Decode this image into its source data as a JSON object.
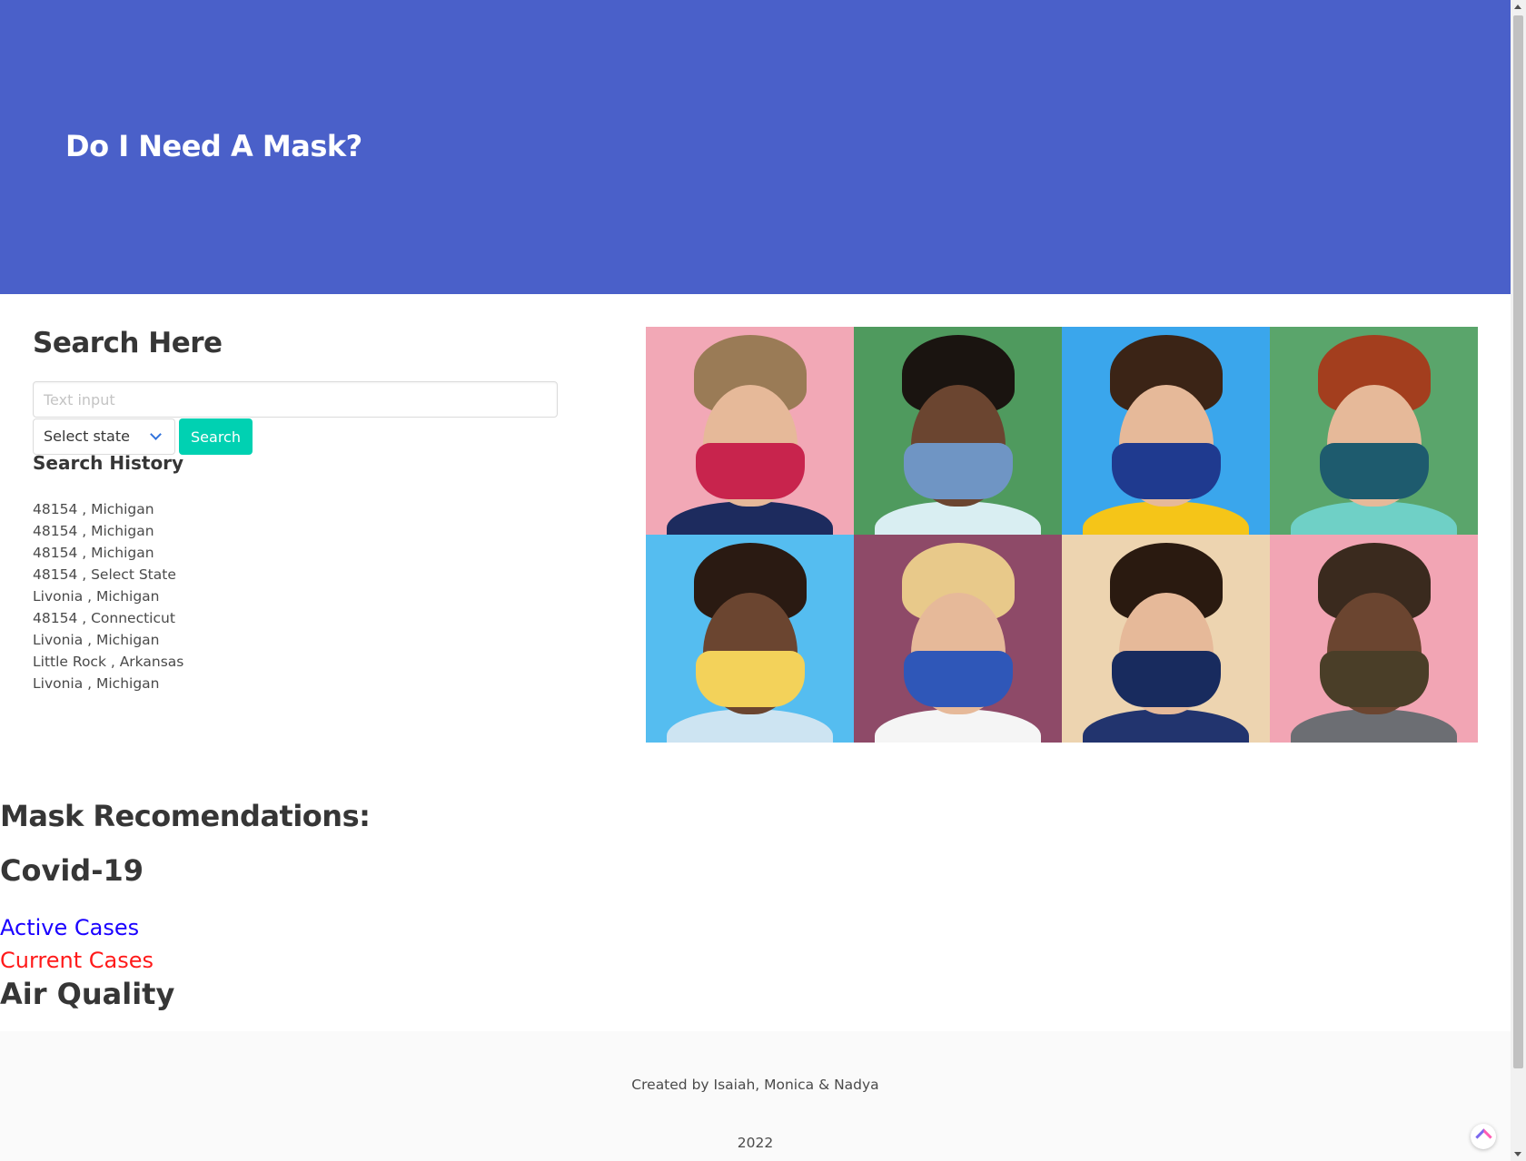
{
  "hero": {
    "title": "Do I Need A Mask?",
    "color": "#4a60c9"
  },
  "search": {
    "heading": "Search Here",
    "input_placeholder": "Text input",
    "input_value": "",
    "state_select_value": "Select state",
    "button_label": "Search",
    "button_color": "#00d1b2"
  },
  "history": {
    "heading": "Search History",
    "items": [
      "48154 , Michigan",
      "48154 , Michigan",
      "48154 , Michigan",
      "48154 , Select State",
      "Livonia , Michigan",
      "48154 , Connecticut",
      "Livonia , Michigan",
      "Little Rock , Arkansas",
      "Livonia , Michigan"
    ]
  },
  "photos": [
    {
      "bg": "#f2a8b6",
      "mask": "#c8244d",
      "hair": "#9a7b56",
      "shirt": "#1d2b5e"
    },
    {
      "bg": "#4f9a5e",
      "mask": "#6f95c4",
      "hair": "#1a1410",
      "shirt": "#d9eef2"
    },
    {
      "bg": "#3aa6ec",
      "mask": "#1f3a8f",
      "hair": "#3b2416",
      "shirt": "#f5c518"
    },
    {
      "bg": "#5aa56b",
      "mask": "#1e5b6e",
      "hair": "#a33e1e",
      "shirt": "#6fd0c6"
    },
    {
      "bg": "#55bdf0",
      "mask": "#f3d25a",
      "hair": "#2a1a12",
      "shirt": "#cde4f2"
    },
    {
      "bg": "#8e4a68",
      "mask": "#2f57b8",
      "hair": "#e8c98a",
      "shirt": "#f5f5f5"
    },
    {
      "bg": "#edd4b0",
      "mask": "#182b5e",
      "hair": "#2a1a10",
      "shirt": "#22346e"
    },
    {
      "bg": "#f2a5b4",
      "mask": "#4a3e28",
      "hair": "#3a2a1e",
      "shirt": "#6c6e73"
    }
  ],
  "recommendations": {
    "heading": "Mask Recomendations:",
    "covid_heading": "Covid-19",
    "active_cases_label": "Active Cases",
    "current_cases_label": "Current Cases",
    "air_quality_heading": "Air Quality"
  },
  "footer": {
    "credit": "Created by Isaiah, Monica & Nadya",
    "year": "2022"
  }
}
